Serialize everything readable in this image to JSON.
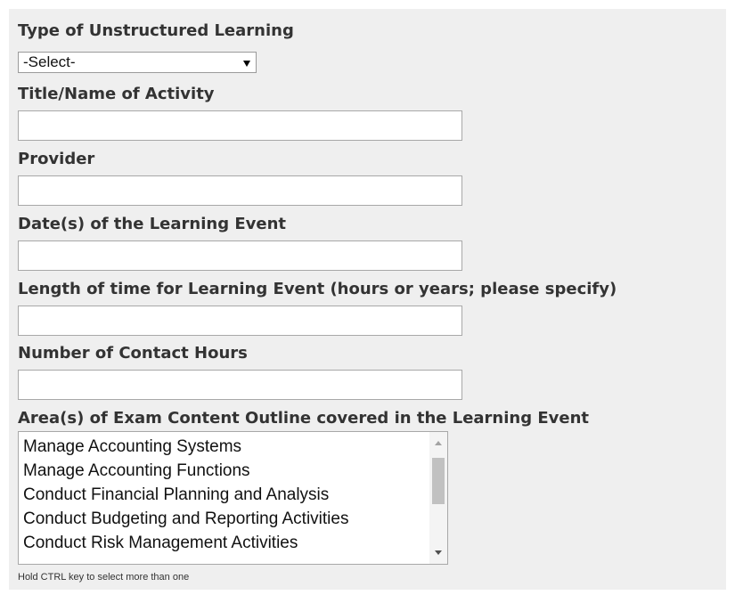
{
  "form": {
    "type_label": "Type of Unstructured Learning",
    "type_select_value": "-Select-",
    "title_label": "Title/Name of Activity",
    "title_value": "",
    "provider_label": "Provider",
    "provider_value": "",
    "dates_label": "Date(s) of the Learning Event",
    "dates_value": "",
    "length_label": "Length of time for Learning Event (hours or years; please specify)",
    "length_value": "",
    "contact_hours_label": "Number of Contact Hours",
    "contact_hours_value": "",
    "areas_label": "Area(s) of Exam Content Outline covered in the Learning Event",
    "areas_options": [
      "Manage Accounting Systems",
      "Manage Accounting Functions",
      "Conduct Financial Planning and Analysis",
      "Conduct Budgeting and Reporting Activities",
      "Conduct Risk Management Activities"
    ],
    "hint": "Hold CTRL key to select more than one"
  },
  "colors": {
    "panel_background": "#efefef",
    "label_text": "#333333",
    "input_border": "#a8a8a8"
  },
  "icons": {
    "select_arrow": "triangle-down-icon",
    "scroll_up": "triangle-up-icon",
    "scroll_down": "triangle-down-icon"
  }
}
